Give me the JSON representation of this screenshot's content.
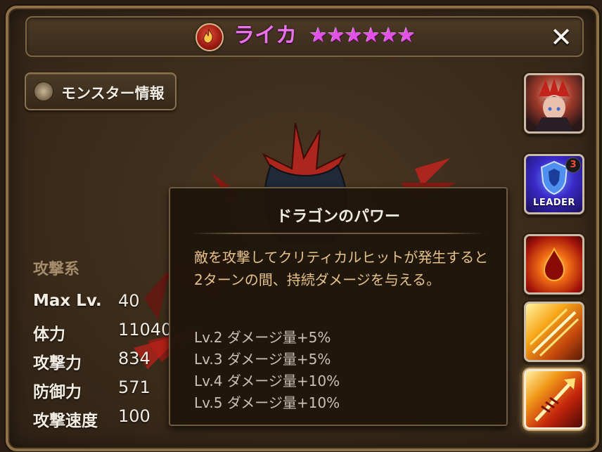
{
  "header": {
    "monster_name": "ライカ",
    "stars": [
      "★",
      "★",
      "★",
      "★",
      "★",
      "★"
    ],
    "close_glyph": "✕",
    "colors": {
      "name": "#e873e6",
      "stars": "#e252e6",
      "element": "fire-red"
    }
  },
  "info_button": {
    "label": "モンスター情報"
  },
  "stats": {
    "type_label": "攻撃系",
    "rows": [
      {
        "label": "Max Lv.",
        "value": "40"
      },
      {
        "label": "体力",
        "value": "11040"
      },
      {
        "label": "攻撃力",
        "value": "834"
      },
      {
        "label": "防御力",
        "value": "571"
      },
      {
        "label": "攻撃速度",
        "value": "100"
      }
    ]
  },
  "side_panel": {
    "leader_label": "LEADER",
    "leader_badge": "3"
  },
  "tooltip": {
    "title": "ドラゴンのパワー",
    "description": "敵を攻撃してクリティカルヒットが発生すると2ターンの間、持続ダメージを与える。",
    "levels": [
      "Lv.2 ダメージ量+5%",
      "Lv.3 ダメージ量+5%",
      "Lv.4 ダメージ量+10%",
      "Lv.5 ダメージ量+10%"
    ]
  }
}
